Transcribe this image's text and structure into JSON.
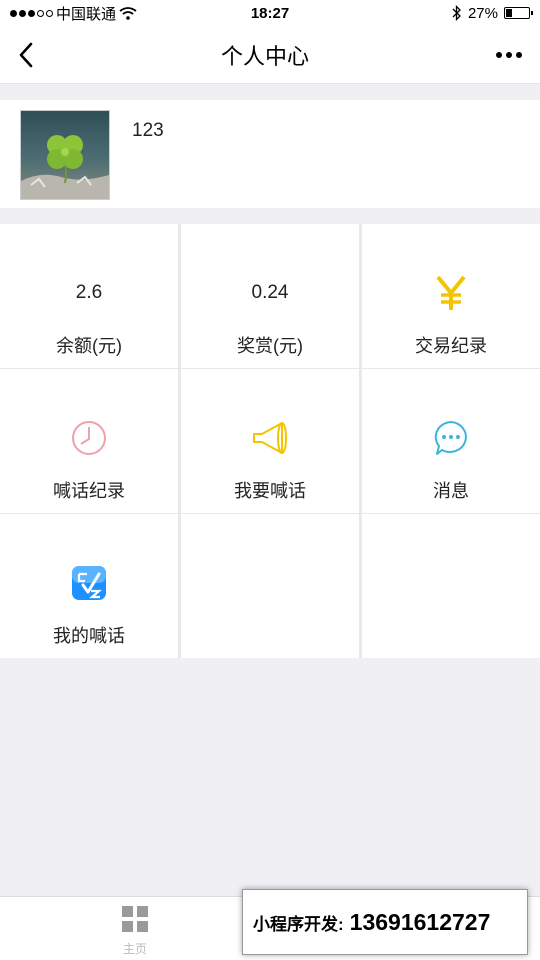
{
  "status_bar": {
    "carrier": "中国联通",
    "time": "18:27",
    "battery": "27%",
    "battery_level": 0.27
  },
  "nav": {
    "title": "个人中心",
    "back_icon": "chevron-left-icon",
    "more_icon": "more-icon"
  },
  "profile": {
    "avatar_icon": "clover-avatar",
    "username": "123"
  },
  "grid": [
    {
      "value": "2.6",
      "label": "余额(元)"
    },
    {
      "value": "0.24",
      "label": "奖赏(元)"
    },
    {
      "icon": "yen-icon",
      "symbol": "¥",
      "label": "交易纪录",
      "color": "#f5c400"
    },
    {
      "icon": "clock-icon",
      "label": "喊话纪录",
      "color": "#f0a0a8"
    },
    {
      "icon": "megaphone-icon",
      "label": "我要喊话",
      "color": "#f5c400"
    },
    {
      "icon": "chat-bubble-icon",
      "label": "消息",
      "color": "#3bb6d8"
    },
    {
      "icon": "app-badge-icon",
      "label": "我的喊话",
      "color": "#1e90ff"
    }
  ],
  "tab_bar": {
    "home_label": "主页",
    "home_icon": "grid-icon"
  },
  "promo": {
    "label": "小程序开发:",
    "phone": "13691612727"
  }
}
